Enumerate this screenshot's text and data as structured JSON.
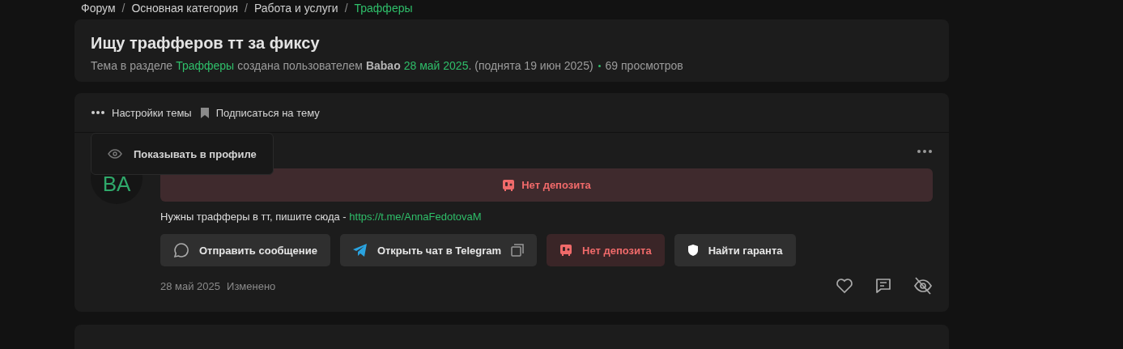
{
  "breadcrumbs": [
    {
      "label": "Форум",
      "current": false
    },
    {
      "label": "Основная категория",
      "current": false
    },
    {
      "label": "Работа и услуги",
      "current": false
    },
    {
      "label": "Трафферы",
      "current": true
    }
  ],
  "breadcrumb_separator": "/",
  "thread": {
    "title": "Ищу трафферов тт за фиксу",
    "meta": {
      "prefix": "Тема в разделе",
      "section": "Трафферы",
      "created_by": "создана пользователем",
      "author": "Babao",
      "date": "28 май 2025",
      "bumped": ". (поднята 19 июн 2025)",
      "views": "69 просмотров"
    }
  },
  "toolbar": [
    {
      "kind": "dots",
      "label": "Настройки темы"
    },
    {
      "kind": "bookmark",
      "label": "Подписаться на тему"
    }
  ],
  "menu": {
    "items": [
      {
        "kind": "eye",
        "label": "Показывать в профиле"
      }
    ]
  },
  "post": {
    "avatar": "BA",
    "deposit_banner": "Нет депозита",
    "message": {
      "text": "Нужны трафферы в тт, пишите сюда -",
      "link": "https://t.me/AnnaFedotovaM"
    },
    "buttons": [
      {
        "kind": "message",
        "label": "Отправить сообщение"
      },
      {
        "kind": "telegram",
        "label": "Открыть чат в Telegram"
      },
      {
        "kind": "deposit",
        "label": "Нет депозита"
      },
      {
        "kind": "shield",
        "label": "Найти гаранта"
      }
    ],
    "date": "28 май 2025",
    "edited": "Изменено",
    "actions": [
      {
        "kind": "like"
      },
      {
        "kind": "reply"
      },
      {
        "kind": "hide"
      }
    ]
  }
}
